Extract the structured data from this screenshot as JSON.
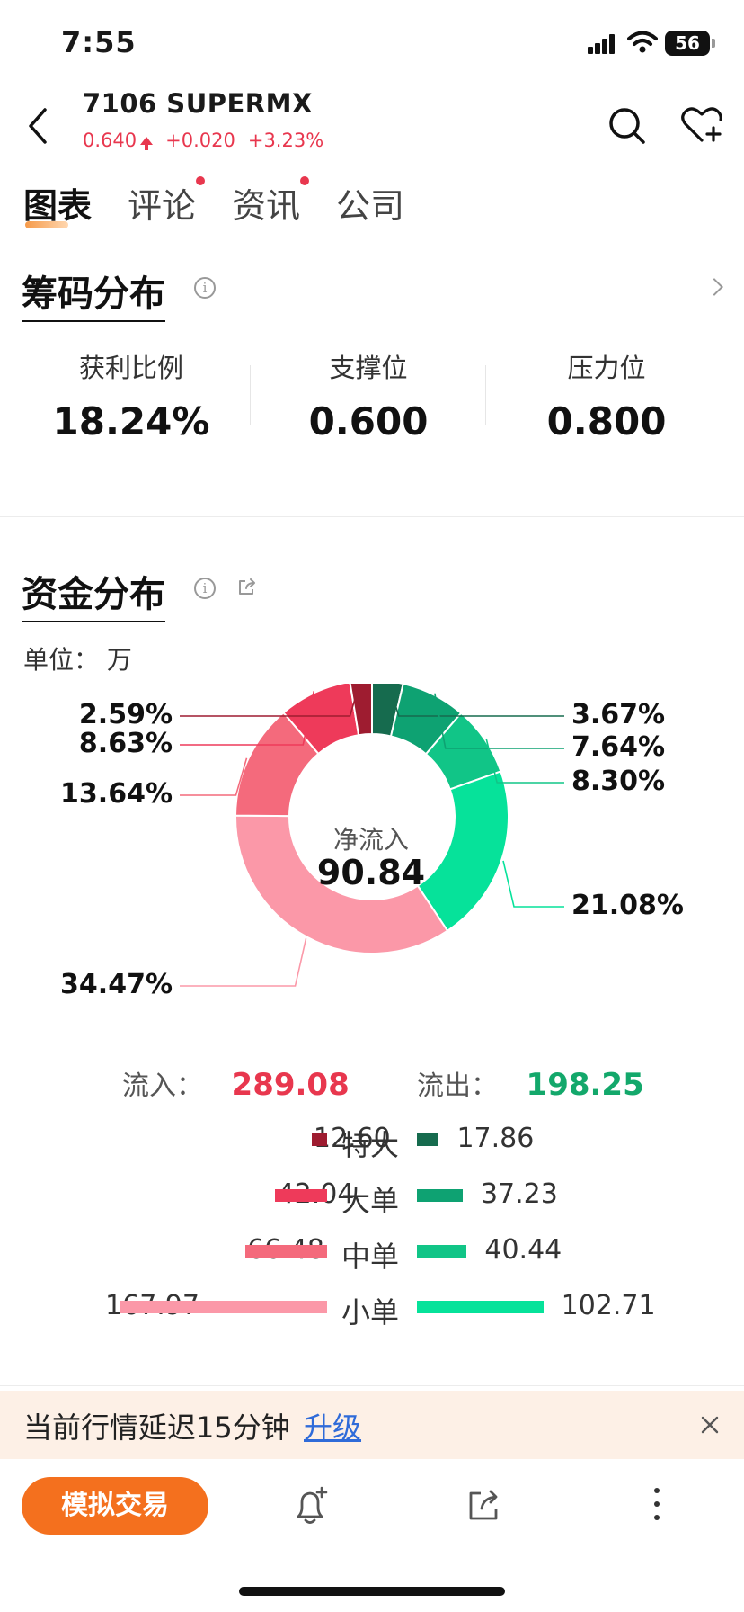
{
  "status_bar": {
    "time": "7:55",
    "battery": "56"
  },
  "header": {
    "title": "7106  SUPERMX",
    "price": "0.640",
    "change": "+0.020",
    "change_pct": "+3.23%",
    "quote_color": "#e8374e"
  },
  "tabs": [
    {
      "label": "图表",
      "active": true,
      "dot": false
    },
    {
      "label": "评论",
      "active": false,
      "dot": true
    },
    {
      "label": "资讯",
      "active": false,
      "dot": true
    },
    {
      "label": "公司",
      "active": false,
      "dot": false
    }
  ],
  "chip_distribution": {
    "title": "筹码分布",
    "stats": [
      {
        "label": "获利比例",
        "value": "18.24%"
      },
      {
        "label": "支撑位",
        "value": "0.600"
      },
      {
        "label": "压力位",
        "value": "0.800"
      }
    ]
  },
  "fund_distribution": {
    "title": "资金分布",
    "unit": "单位：  万",
    "center_label": "净流入",
    "center_value": "90.84",
    "inflow_label": "流入：",
    "inflow_value": "289.08",
    "outflow_label": "流出：",
    "outflow_value": "198.25",
    "categories": [
      {
        "name": "特大",
        "in": "12.60",
        "out": "17.86",
        "in_color": "#9e1c30",
        "out_color": "#166b4e"
      },
      {
        "name": "大单",
        "in": "42.04",
        "out": "37.23",
        "in_color": "#ee3a5a",
        "out_color": "#0ea272"
      },
      {
        "name": "中单",
        "in": "66.48",
        "out": "40.44",
        "in_color": "#f46a7c",
        "out_color": "#11c587"
      },
      {
        "name": "小单",
        "in": "167.97",
        "out": "102.71",
        "in_color": "#fb98a8",
        "out_color": "#06e29a"
      }
    ]
  },
  "chart_data": {
    "type": "pie",
    "variant": "donut",
    "slices": [
      {
        "label": "3.67%",
        "value": 3.67,
        "color": "#166b4e"
      },
      {
        "label": "7.64%",
        "value": 7.64,
        "color": "#0ea272"
      },
      {
        "label": "8.30%",
        "value": 8.3,
        "color": "#11c587"
      },
      {
        "label": "21.08%",
        "value": 21.08,
        "color": "#06e29a"
      },
      {
        "label": "34.47%",
        "value": 34.47,
        "color": "#fb98a8"
      },
      {
        "label": "13.64%",
        "value": 13.64,
        "color": "#f46a7c"
      },
      {
        "label": "8.63%",
        "value": 8.63,
        "color": "#ee3a5a"
      },
      {
        "label": "2.59%",
        "value": 2.59,
        "color": "#9e1c30"
      }
    ]
  },
  "banner": {
    "text": "当前行情延迟15分钟",
    "link": "升级"
  },
  "bottom_bar": {
    "simulate_label": "模拟交易"
  }
}
